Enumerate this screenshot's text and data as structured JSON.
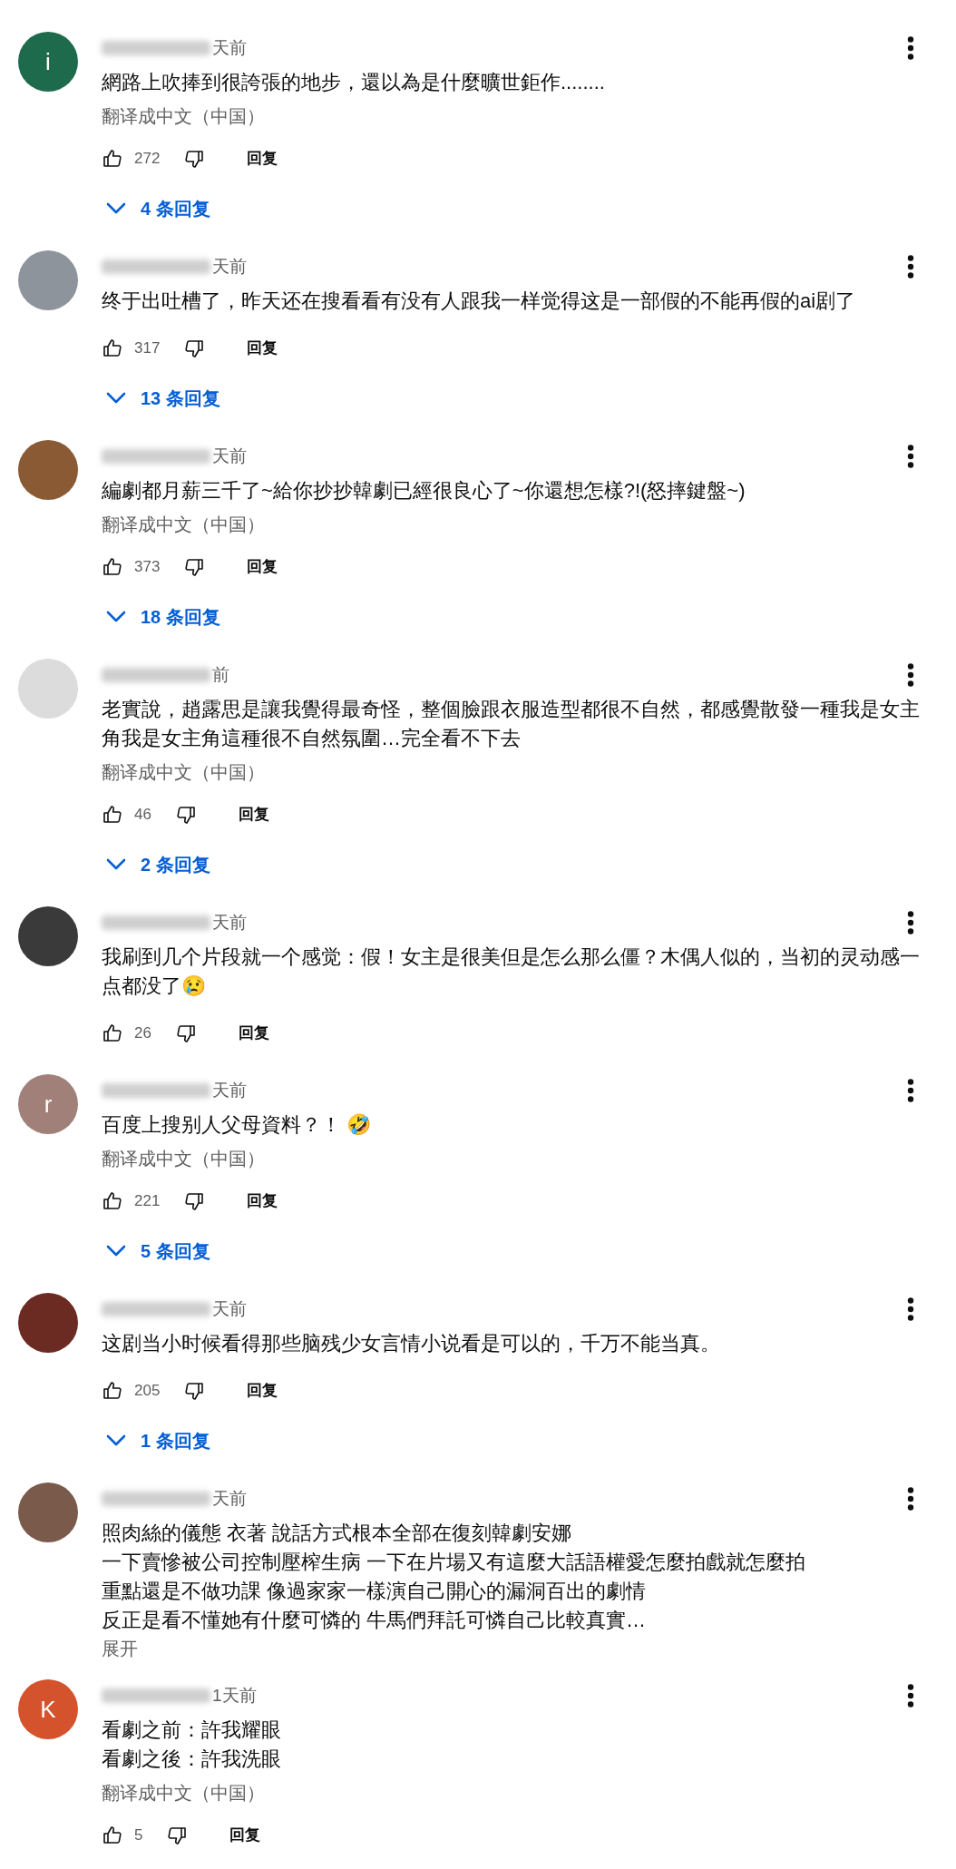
{
  "comments": [
    {
      "avatar": {
        "color": "#1d6a4d",
        "letter": "i"
      },
      "time": "天前",
      "lines": [
        "網路上吹捧到很誇張的地步，還以為是什麼曠世鉅作........"
      ],
      "translate": "翻译成中文（中国）",
      "likes": "272",
      "reply_label": "回复",
      "replies": "4 条回复"
    },
    {
      "avatar": {
        "color": "#8d949c"
      },
      "time": "天前",
      "lines": [
        "终于出吐槽了，昨天还在搜看看有没有人跟我一样觉得这是一部假的不能再假的ai剧了"
      ],
      "likes": "317",
      "reply_label": "回复",
      "replies": "13 条回复"
    },
    {
      "avatar": {
        "color": "#8a5a35"
      },
      "time": "天前",
      "lines": [
        "編劇都月薪三千了~給你抄抄韓劇已經很良心了~你還想怎樣?!(怒摔鍵盤~)"
      ],
      "translate": "翻译成中文（中国）",
      "likes": "373",
      "reply_label": "回复",
      "replies": "18 条回复"
    },
    {
      "avatar": {
        "color": "#dcdcdc"
      },
      "time": "前",
      "lines": [
        "老實說，趙露思是讓我覺得最奇怪，整個臉跟衣服造型都很不自然，都感覺散發一種我是女主",
        "角我是女主角這種很不自然氛圍…完全看不下去"
      ],
      "translate": "翻译成中文（中国）",
      "likes": "46",
      "reply_label": "回复",
      "replies": "2 条回复"
    },
    {
      "avatar": {
        "color": "#3a3a3a"
      },
      "time": "天前",
      "lines": [
        "我刷到几个片段就一个感觉：假！女主是很美但是怎么那么僵？木偶人似的，当初的灵动感一",
        "点都没了😢"
      ],
      "likes": "26",
      "reply_label": "回复"
    },
    {
      "avatar": {
        "color": "#a08078",
        "letter": "r"
      },
      "time": "天前",
      "lines": [
        "百度上搜别人父母資料？！ 🤣"
      ],
      "translate": "翻译成中文（中国）",
      "likes": "221",
      "reply_label": "回复",
      "replies": "5 条回复"
    },
    {
      "avatar": {
        "color": "#6b2a22"
      },
      "time": "天前",
      "lines": [
        "这剧当小时候看得那些脑残少女言情小说看是可以的，千万不能当真。"
      ],
      "likes": "205",
      "reply_label": "回复",
      "replies": "1 条回复"
    },
    {
      "avatar": {
        "color": "#7a5a4a"
      },
      "time": "天前",
      "lines": [
        "照肉絲的儀態 衣著 說話方式根本全部在復刻韓劇安娜",
        "一下賣慘被公司控制壓榨生病 一下在片場又有這麼大話語權愛怎麼拍戲就怎麼拍",
        "重點還是不做功課 像過家家一樣演自己開心的漏洞百出的劇情",
        "反正是看不懂她有什麼可憐的 牛馬們拜託可憐自己比較真實…"
      ],
      "more": "展开"
    },
    {
      "avatar": {
        "color": "#d4532c",
        "letter": "K"
      },
      "time": "1天前",
      "lines": [
        "看劇之前：許我耀眼",
        "看劇之後：許我洗眼"
      ],
      "translate": "翻译成中文（中国）",
      "likes": "5",
      "reply_label": "回复"
    }
  ]
}
